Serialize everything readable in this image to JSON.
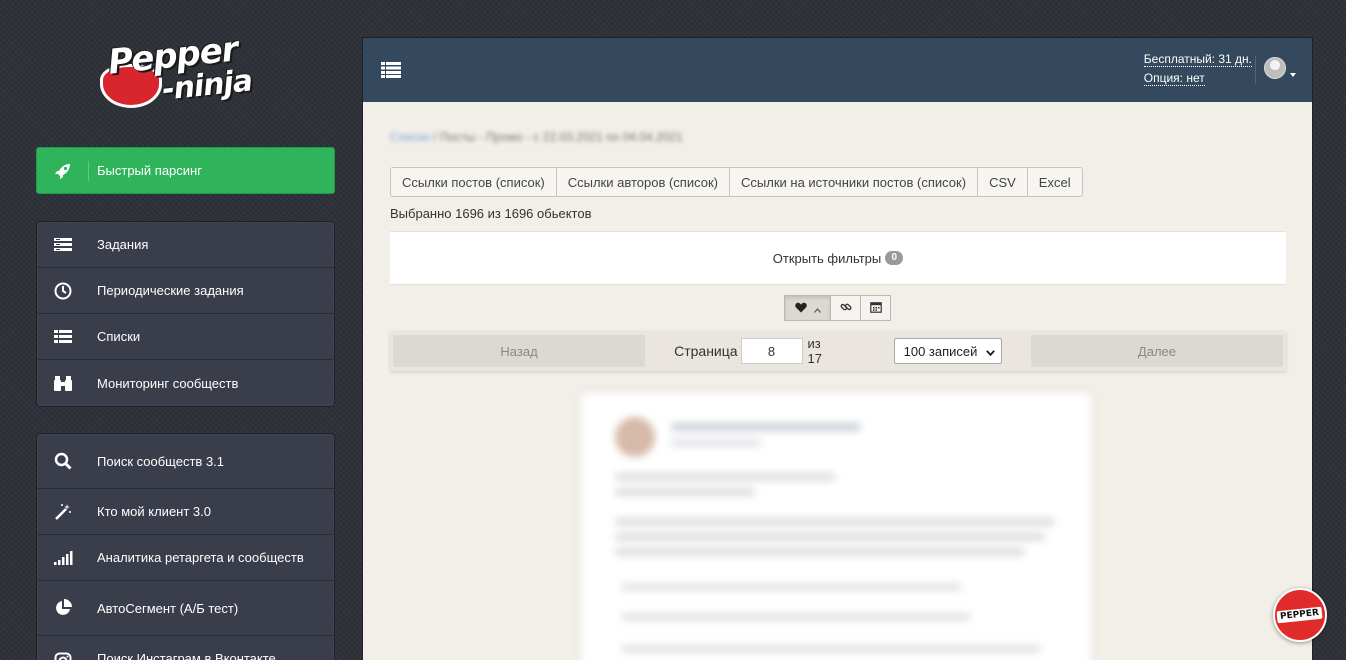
{
  "logo": {
    "line1": "Pepper",
    "line2": "-ninja"
  },
  "sidebar": {
    "quick": {
      "label": "Быстрый парсинг",
      "icon": "rocket-icon"
    },
    "group1": [
      {
        "label": "Задания",
        "icon": "tasks-icon"
      },
      {
        "label": "Периодические задания",
        "icon": "clock-icon"
      },
      {
        "label": "Списки",
        "icon": "list-icon"
      },
      {
        "label": "Мониторинг сообществ",
        "icon": "binoculars-icon"
      }
    ],
    "group2": [
      {
        "label": "Поиск сообществ 3.1",
        "icon": "search-icon"
      },
      {
        "label": "Кто мой клиент 3.0",
        "icon": "magic-wand-icon"
      },
      {
        "label": "Аналитика ретаргета и сообществ",
        "icon": "signal-icon"
      },
      {
        "label": "АвтоСегмент (А/Б тест)",
        "icon": "pie-chart-icon"
      },
      {
        "label": "Поиск Инстаграм в Вконтакте",
        "icon": "instagram-icon"
      }
    ]
  },
  "header": {
    "plan": "Бесплатный: 31 дн.",
    "option": "Опция: нет"
  },
  "breadcrumb": {
    "link": "Списки",
    "rest": " / Посты - Промо - с 22.03.2021 по 04.04.2021"
  },
  "export": {
    "buttons": [
      "Ссылки постов (список)",
      "Ссылки авторов (список)",
      "Ссылки на источники постов (список)",
      "CSV",
      "Excel"
    ]
  },
  "selection": {
    "text": "Выбранно 1696 из 1696 обьектов"
  },
  "filters": {
    "label": "Открыть фильтры",
    "count": "0"
  },
  "sort": {
    "active": "likes",
    "icons": [
      "heart-icon",
      "link-icon",
      "calendar-icon"
    ]
  },
  "pager": {
    "prev": "Назад",
    "page_label": "Страница",
    "page": "8",
    "of": "из 17",
    "page_size": "100 записей",
    "next": "Далее"
  },
  "badge": {
    "text": "PEPPER"
  },
  "colors": {
    "green": "#2fb45c",
    "topbar": "#34495e",
    "sidebar": "#3a3d4a",
    "panel": "#f2eee8"
  }
}
